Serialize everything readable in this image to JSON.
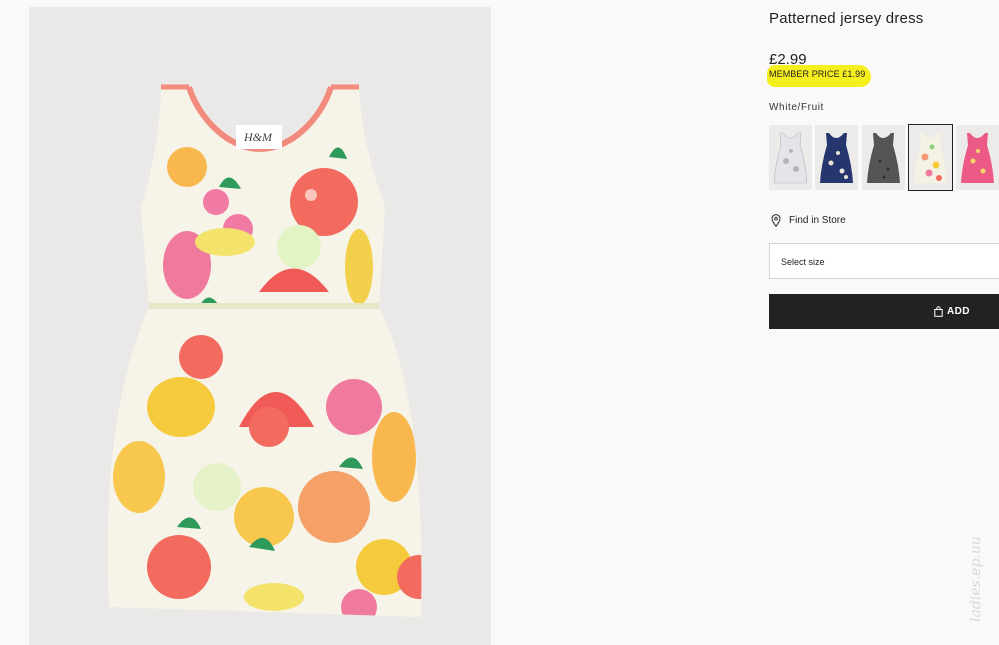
{
  "product": {
    "title": "Patterned jersey dress",
    "price": "£2.99",
    "member_price": "MEMBER PRICE £1.99",
    "color_name": "White/Fruit",
    "image_logo": "H&M"
  },
  "swatches": [
    {
      "name": "grey-print",
      "base": "#e3e1df",
      "accent": "#b7b4b9",
      "selected": false
    },
    {
      "name": "navy-print",
      "base": "#25356e",
      "accent": "#e9e5d4",
      "selected": false
    },
    {
      "name": "dark-grey-print",
      "base": "#555558",
      "accent": "#2f2f31",
      "selected": false
    },
    {
      "name": "white-fruit",
      "base": "#f4f2e4",
      "accent": "#f49a74",
      "selected": true
    },
    {
      "name": "pink-print",
      "base": "#ec5a86",
      "accent": "#f7d66a",
      "selected": false
    }
  ],
  "store": {
    "find_label": "Find in Store",
    "icon": "location-pin-icon"
  },
  "size": {
    "placeholder": "Select size"
  },
  "add": {
    "label": "ADD",
    "icon": "shopping-bag-icon"
  },
  "watermark": "ladies.ep.uu",
  "colors": {
    "highlight": "#f5ef1e",
    "button": "#222222",
    "background": "#faf9f8",
    "image_bg": "#ebe9e7"
  }
}
